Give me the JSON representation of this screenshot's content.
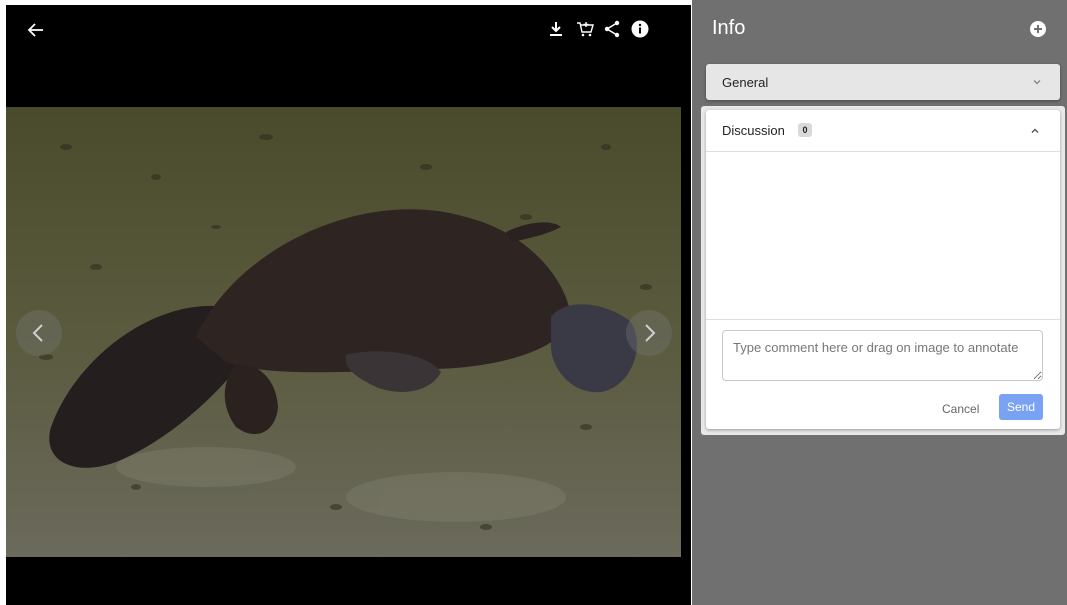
{
  "viewer": {
    "back_icon": "arrow-left-icon",
    "tools": [
      "download-icon",
      "cart-add-icon",
      "share-icon",
      "info-icon"
    ],
    "prev_icon": "chevron-left-icon",
    "next_icon": "chevron-right-icon"
  },
  "panel": {
    "title": "Info",
    "add_icon": "plus-circle-icon",
    "general": {
      "label": "General",
      "expanded": false
    },
    "discussion": {
      "label": "Discussion",
      "count": "0",
      "expanded": true,
      "comment_placeholder": "Type comment here or drag on image to annotate",
      "comment_value": "",
      "cancel_label": "Cancel",
      "send_label": "Send"
    }
  },
  "colors": {
    "panel_bg": "#707070",
    "viewer_bg": "#000000",
    "send_button": "#7aa2f2"
  }
}
